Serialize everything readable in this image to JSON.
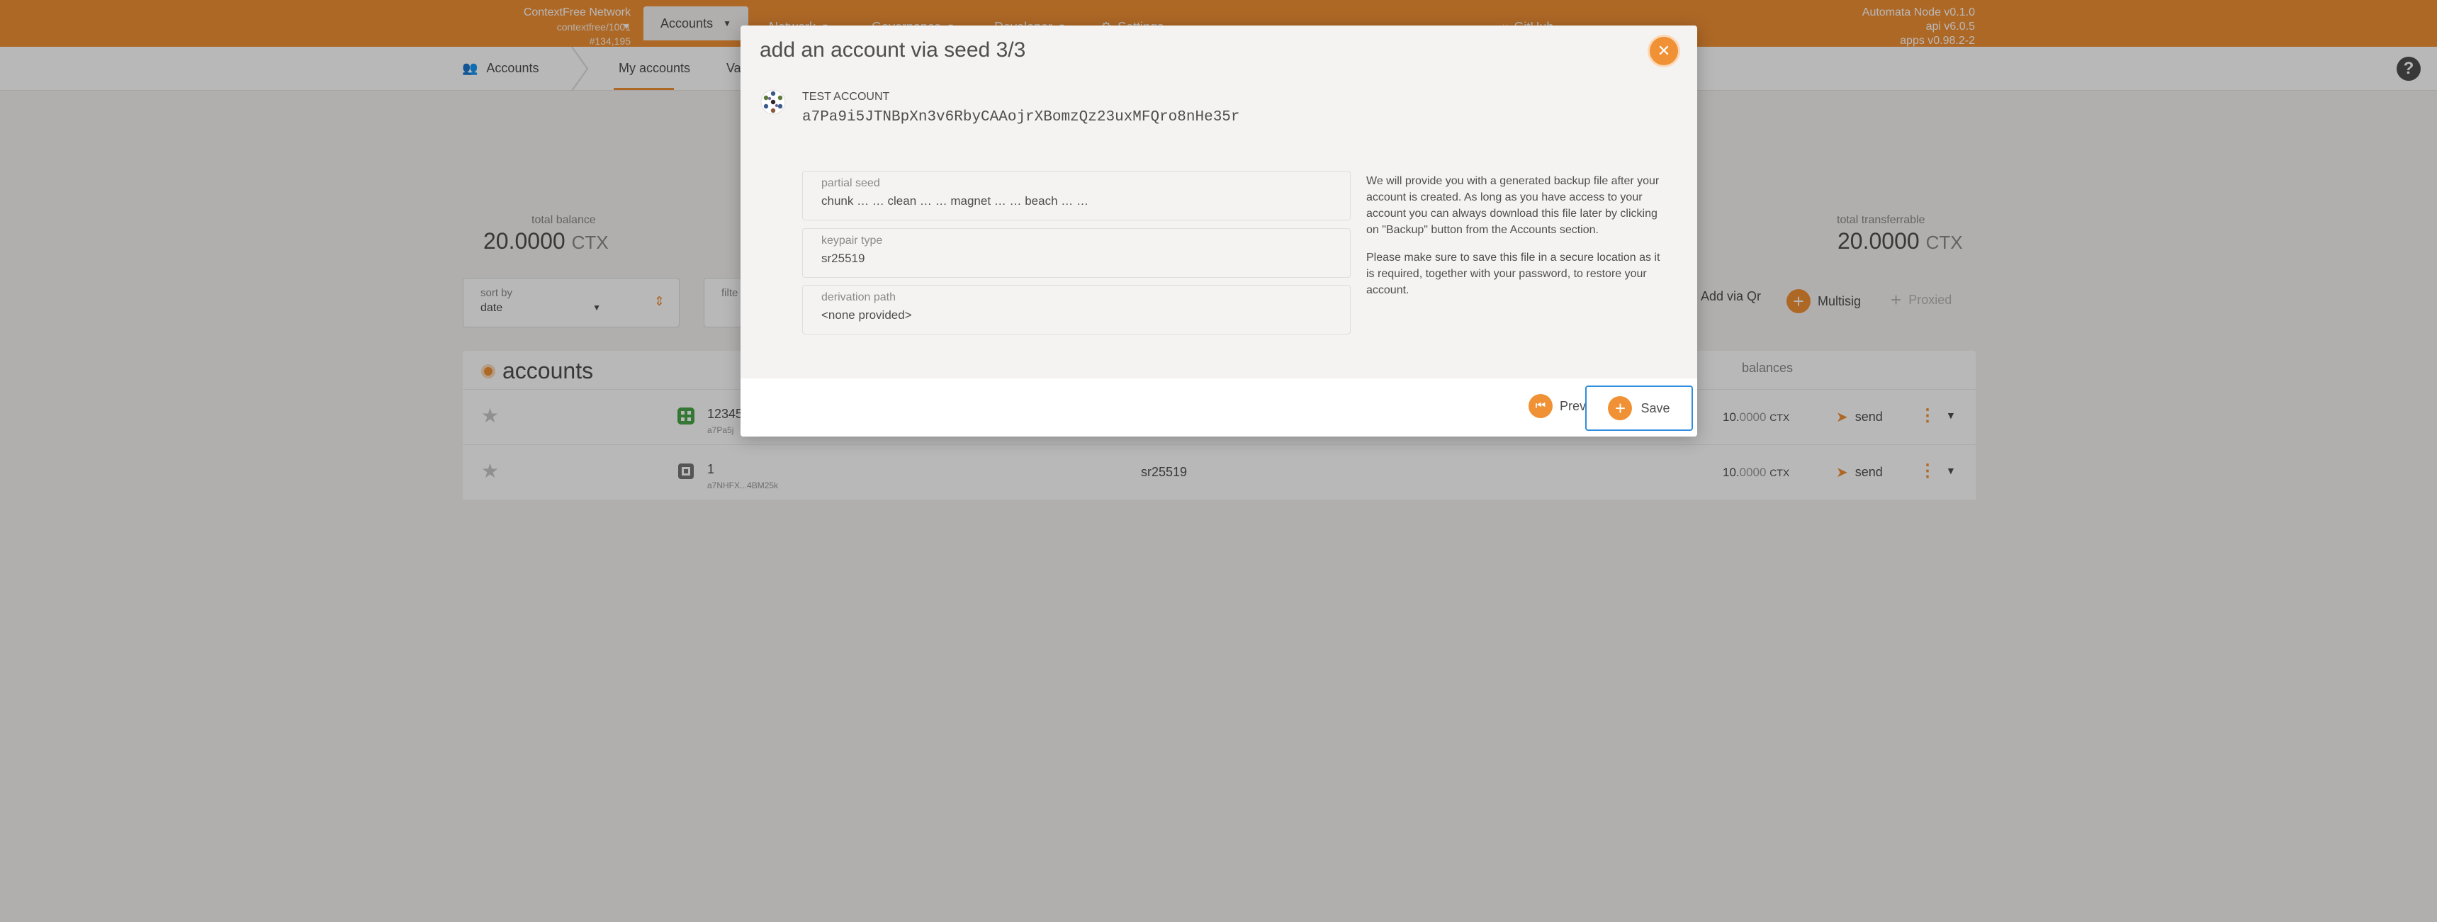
{
  "header": {
    "chain_name": "ContextFree Network",
    "chain_sub": "contextfree/1001",
    "block_number": "#134,195",
    "menu": [
      {
        "label": "Accounts"
      },
      {
        "label": "Network"
      },
      {
        "label": "Governance"
      },
      {
        "label": "Developer"
      },
      {
        "label": "Settings"
      },
      {
        "label": "GitHub"
      }
    ],
    "node_lines": [
      "Automata Node v0.1.0",
      "api v6.0.5",
      "apps v0.98.2-2"
    ]
  },
  "subnav": {
    "section": "Accounts",
    "tab_active": "My accounts",
    "tab_2": "Va"
  },
  "summary": {
    "total_balance_label": "total balance",
    "total_balance_int": "20.0000",
    "total_balance_unit": "CTX",
    "total_transferrable_label": "total transferrable",
    "total_transferrable_int": "20.0000",
    "total_transferrable_unit": "CTX"
  },
  "controls": {
    "sort_label": "sort by",
    "sort_value": "date",
    "filter_label": "filte",
    "add_via_qr": "Add via Qr",
    "multisig": "Multisig",
    "proxied": "Proxied"
  },
  "table": {
    "title": "accounts",
    "balances_header": "balances",
    "rows": [
      {
        "name": "12345",
        "address": "a7Pa5j",
        "type": "",
        "amount_int": "10.",
        "amount_dec": "0000",
        "unit": "CTX",
        "send": "send"
      },
      {
        "name": "1",
        "address": "a7NHFX...4BM25k",
        "type": "sr25519",
        "amount_int": "10.",
        "amount_dec": "0000",
        "unit": "CTX",
        "send": "send"
      }
    ]
  },
  "modal": {
    "title": "add an account via seed 3/3",
    "account_name": "TEST ACCOUNT",
    "account_address": "a7Pa9i5JTNBpXn3v6RbyCAAojrXBomzQz23uxMFQro8nHe35r",
    "fields": [
      {
        "label": "partial seed",
        "value": "chunk … … clean … … magnet … … beach … …"
      },
      {
        "label": "keypair type",
        "value": "sr25519"
      },
      {
        "label": "derivation path",
        "value": "<none provided>"
      }
    ],
    "help_1": "We will provide you with a generated backup file after your account is created. As long as you have access to your account you can always download this file later by clicking on \"Backup\" button from the Accounts section.",
    "help_2": "Please make sure to save this file in a secure location as it is required, together with your password, to restore your account.",
    "prev_label": "Prev",
    "save_label": "Save"
  },
  "colors": {
    "accent": "#f19135",
    "focus": "#2f8ce0"
  }
}
